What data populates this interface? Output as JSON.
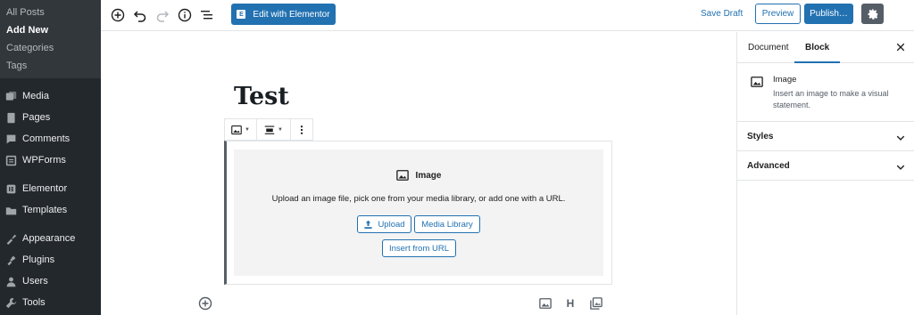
{
  "admin_menu": {
    "submenu": [
      {
        "label": "All Posts",
        "current": false
      },
      {
        "label": "Add New",
        "current": true
      },
      {
        "label": "Categories",
        "current": false
      },
      {
        "label": "Tags",
        "current": false
      }
    ],
    "items": [
      {
        "label": "Media",
        "icon": "media-icon"
      },
      {
        "label": "Pages",
        "icon": "pages-icon"
      },
      {
        "label": "Comments",
        "icon": "comments-icon"
      },
      {
        "label": "WPForms",
        "icon": "wpforms-icon"
      },
      {
        "label": "Elementor",
        "icon": "elementor-icon"
      },
      {
        "label": "Templates",
        "icon": "templates-icon"
      },
      {
        "label": "Appearance",
        "icon": "appearance-icon"
      },
      {
        "label": "Plugins",
        "icon": "plugins-icon"
      },
      {
        "label": "Users",
        "icon": "users-icon"
      },
      {
        "label": "Tools",
        "icon": "tools-icon"
      }
    ]
  },
  "toolbar": {
    "elementor_label": "Edit with Elementor",
    "save_draft_label": "Save Draft",
    "preview_label": "Preview",
    "publish_label": "Publish…"
  },
  "editor": {
    "post_title": "Test",
    "image_block": {
      "label": "Image",
      "instructions": "Upload an image file, pick one from your media library, or add one with a URL.",
      "upload_label": "Upload",
      "media_library_label": "Media Library",
      "insert_url_label": "Insert from URL"
    },
    "heading_shortcut": "H"
  },
  "settings_sidebar": {
    "tabs": [
      {
        "label": "Document",
        "active": false
      },
      {
        "label": "Block",
        "active": true
      }
    ],
    "block_card": {
      "title": "Image",
      "description": "Insert an image to make a visual statement."
    },
    "panels": [
      {
        "label": "Styles"
      },
      {
        "label": "Advanced"
      }
    ]
  },
  "colors": {
    "accent": "#2271b1",
    "admin_bg": "#23282d",
    "admin_submenu_bg": "#32373c",
    "settings_active": "#555d66"
  }
}
